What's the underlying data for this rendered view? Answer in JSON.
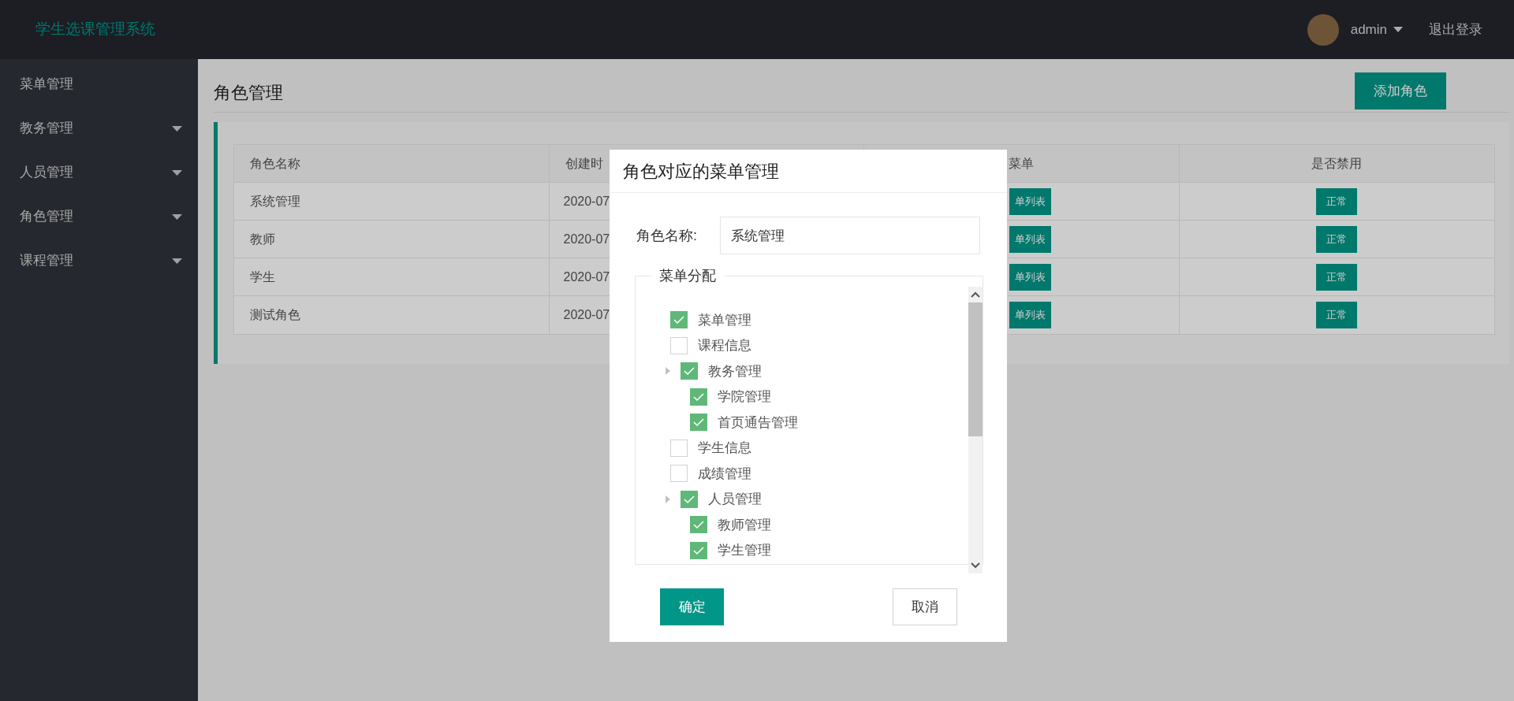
{
  "header": {
    "title": "学生选课管理系统",
    "user": "admin",
    "logout": "退出登录"
  },
  "sidebar": {
    "items": [
      {
        "label": "菜单管理",
        "expandable": false
      },
      {
        "label": "教务管理",
        "expandable": true
      },
      {
        "label": "人员管理",
        "expandable": true
      },
      {
        "label": "角色管理",
        "expandable": true
      },
      {
        "label": "课程管理",
        "expandable": true
      }
    ]
  },
  "page": {
    "title": "角色管理",
    "add_button": "添加角色"
  },
  "table": {
    "columns": [
      "角色名称",
      "创建时",
      "菜单",
      "是否禁用"
    ],
    "rows": [
      {
        "name": "系统管理",
        "created": "2020-07",
        "menu_button": "单列表",
        "status": "正常"
      },
      {
        "name": "教师",
        "created": "2020-07",
        "menu_button": "单列表",
        "status": "正常"
      },
      {
        "name": "学生",
        "created": "2020-07",
        "menu_button": "单列表",
        "status": "正常"
      },
      {
        "name": "测试角色",
        "created": "2020-07",
        "menu_button": "单列表",
        "status": "正常"
      }
    ]
  },
  "dialog": {
    "title": "角色对应的菜单管理",
    "name_label": "角色名称:",
    "name_value": "系统管理",
    "legend": "菜单分配",
    "tree": [
      {
        "label": "菜单管理",
        "checked": true
      },
      {
        "label": "课程信息",
        "checked": false
      },
      {
        "label": "教务管理",
        "checked": true,
        "children": [
          {
            "label": "学院管理",
            "checked": true
          },
          {
            "label": "首页通告管理",
            "checked": true
          }
        ]
      },
      {
        "label": "学生信息",
        "checked": false
      },
      {
        "label": "成绩管理",
        "checked": false
      },
      {
        "label": "人员管理",
        "checked": true,
        "children": [
          {
            "label": "教师管理",
            "checked": true
          },
          {
            "label": "学生管理",
            "checked": true
          }
        ]
      }
    ],
    "confirm": "确定",
    "cancel": "取消"
  }
}
